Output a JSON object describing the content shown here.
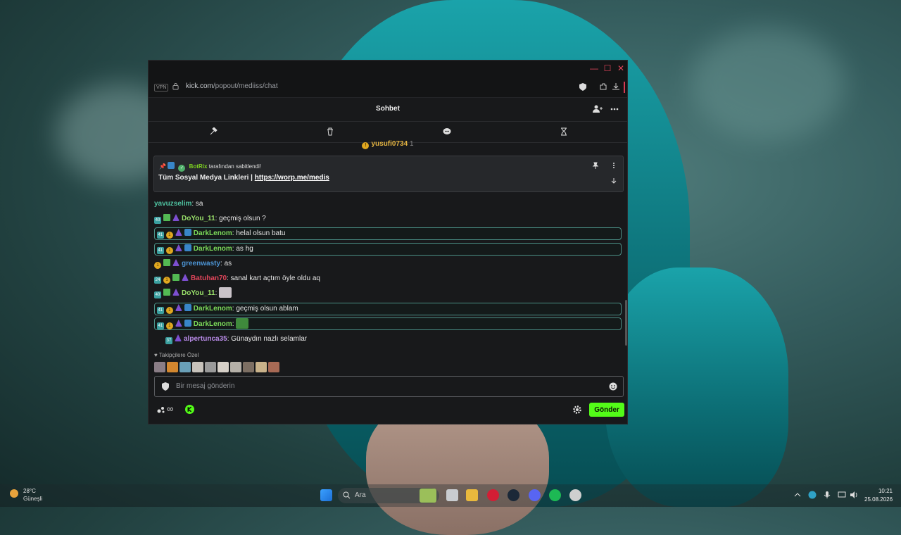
{
  "browser": {
    "vpn_label": "VPN",
    "url_host": "kick.com",
    "url_path": "/popout/mediiss/chat"
  },
  "chat": {
    "title": "Sohbet",
    "gift": {
      "user": "yusufi0734",
      "count": "1"
    },
    "pinned": {
      "author": "BotRix",
      "pinned_by_suffix": "tarafından sabitlendi!",
      "text": "Tüm Sosyal Medya Linkleri | ",
      "link": "https://worp.me/medis"
    },
    "messages": [
      {
        "user": "yavuzselim",
        "color": "#4fc3a1",
        "text": ": sa"
      },
      {
        "user": "DoYou_11",
        "color": "#9be36b",
        "text": ": geçmiş olsun ?"
      },
      {
        "user": "DarkLenom",
        "color": "#7ddc5a",
        "text": ": helal olsun batu"
      },
      {
        "user": "DarkLenom",
        "color": "#7ddc5a",
        "text": ": as hg"
      },
      {
        "user": "greenwasty",
        "color": "#4c94d4",
        "text": ": as"
      },
      {
        "user": "Batuhan70",
        "color": "#e0455a",
        "text": ": sanal kart açtım öyle oldu aq"
      },
      {
        "user": "DoYou_11",
        "color": "#9be36b",
        "text": ":"
      },
      {
        "user": "DarkLenom",
        "color": "#7ddc5a",
        "text": ": geçmiş olsun ablam"
      },
      {
        "user": "DarkLenom",
        "color": "#7ddc5a",
        "text": ":"
      },
      {
        "user": "alpertunca35",
        "color": "#b98be8",
        "text": ": Günaydın nazlı selamlar"
      }
    ],
    "follower_label": "Takipçilere Özel",
    "input_placeholder": "Bir mesaj gönderin",
    "send_label": "Gönder",
    "infinity": "∞"
  },
  "taskbar": {
    "temperature": "28°C",
    "condition": "Güneşli",
    "search_placeholder": "Ara",
    "time": "10:21",
    "date": "25.08.2026"
  }
}
